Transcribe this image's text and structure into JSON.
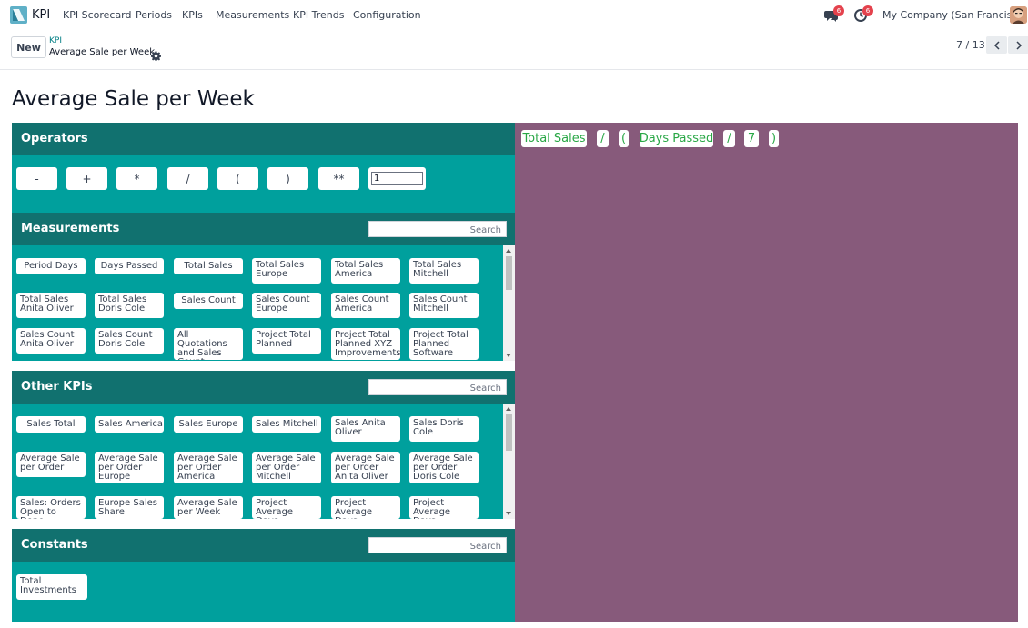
{
  "app": {
    "name": "KPI",
    "menu": [
      "KPI Scorecard",
      "Periods",
      "KPIs",
      "Measurements",
      "KPI Trends",
      "Configuration"
    ],
    "messages_count": "6",
    "activities_count": "6",
    "company": "My Company (San Francisco)"
  },
  "control": {
    "new_label": "New",
    "breadcrumb_parent": "KPI",
    "breadcrumb_current": "Average Sale per Week",
    "pager": "7 / 13"
  },
  "record": {
    "title": "Average Sale per Week"
  },
  "builder": {
    "operators": {
      "title": "Operators",
      "buttons": [
        "-",
        "+",
        "*",
        "/",
        "(",
        ")",
        "**"
      ],
      "constant_value": "1"
    },
    "measurements": {
      "title": "Measurements",
      "search_placeholder": "Search",
      "items": [
        "Period Days",
        "Days Passed",
        "Total Sales",
        "Total Sales Europe",
        "Total Sales America",
        "Total Sales Mitchell",
        "Total Sales Anita Oliver",
        "Total Sales Doris Cole",
        "Sales Count",
        "Sales Count Europe",
        "Sales Count America",
        "Sales Count Mitchell",
        "Sales Count Anita Oliver",
        "Sales Count Doris Cole",
        "All Quotations and Sales Count",
        "Project Total Planned",
        "Project Total Planned XYZ Improvements",
        "Project Total Planned Software"
      ]
    },
    "other_kpis": {
      "title": "Other KPIs",
      "search_placeholder": "Search",
      "items": [
        "Sales Total",
        "Sales America",
        "Sales Europe",
        "Sales Mitchell",
        "Sales Anita Oliver",
        "Sales Doris Cole",
        "Average Sale per Order",
        "Average Sale per Order Europe",
        "Average Sale per Order America",
        "Average Sale per Order Mitchell",
        "Average Sale per Order Anita Oliver",
        "Average Sale per Order Doris Cole",
        "Sales: Orders Open to Done",
        "Europe Sales Share",
        "Average Sale per Week",
        "Project Average Days",
        "Project Average Days",
        "Project Average Days"
      ]
    },
    "constants": {
      "title": "Constants",
      "search_placeholder": "Search",
      "items": [
        "Total Investments"
      ]
    }
  },
  "formula": {
    "tokens": [
      "Total Sales",
      "/",
      "(",
      "Days Passed",
      "/",
      "7",
      ")"
    ]
  },
  "colors": {
    "section_header": "#11716f",
    "section_body": "#00a09d",
    "formula_background": "#875a7b",
    "formula_text": "#28a745",
    "badge": "#e4424d"
  }
}
